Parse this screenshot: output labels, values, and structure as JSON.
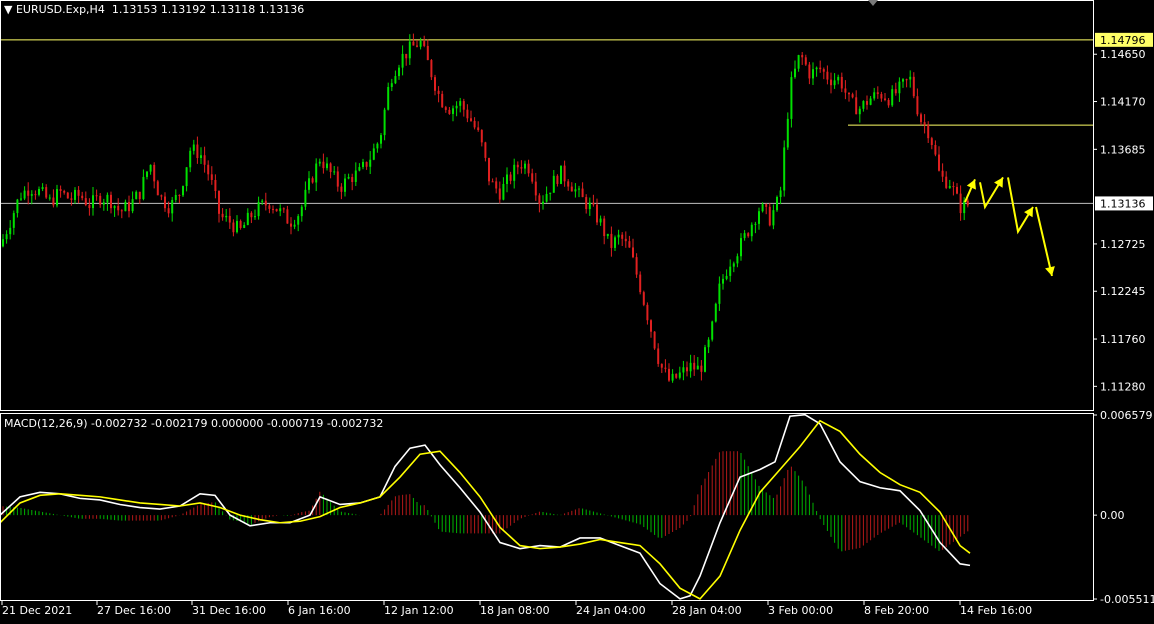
{
  "header": {
    "symbol": "EURUSD.Exp,H4",
    "ohlc": "1.13153 1.13192 1.13118 1.13136"
  },
  "macd_header": {
    "label": "MACD(12,26,9) -0.002732 -0.002179 0.000000 -0.000719 -0.002732"
  },
  "colors": {
    "background": "#000000",
    "bull_candle": "#00e000",
    "bear_candle": "#e02020",
    "frame": "#ffffff",
    "level_line": "#ffff66",
    "current_price_line": "#c0c0c0",
    "macd_main": "#ffffff",
    "macd_signal": "#ffff00",
    "arrow": "#ffff00"
  },
  "price_labels": {
    "resistance": "1.14796",
    "current": "1.13136"
  },
  "chart_data": [
    {
      "type": "candlestick",
      "title": "EURUSD.Exp,H4",
      "ylim": [
        1.1105,
        1.1518
      ],
      "y_ticks": [
        "1.14650",
        "1.14170",
        "1.13685",
        "1.12725",
        "1.12245",
        "1.11760",
        "1.11280"
      ],
      "x_ticks": [
        "21 Dec 2021",
        "27 Dec 16:00",
        "31 Dec 16:00",
        "6 Jan 16:00",
        "12 Jan 12:00",
        "18 Jan 08:00",
        "24 Jan 04:00",
        "28 Jan 04:00",
        "3 Feb 00:00",
        "8 Feb 20:00",
        "14 Feb 16:00"
      ],
      "horizontal_lines": [
        1.14796,
        1.13136,
        1.1393
      ],
      "close_path": [
        [
          0,
          1.127
        ],
        [
          10,
          1.1295
        ],
        [
          20,
          1.1322
        ],
        [
          30,
          1.133
        ],
        [
          40,
          1.1325
        ],
        [
          50,
          1.1315
        ],
        [
          60,
          1.1325
        ],
        [
          70,
          1.1318
        ],
        [
          80,
          1.1322
        ],
        [
          90,
          1.1312
        ],
        [
          100,
          1.132
        ],
        [
          110,
          1.1318
        ],
        [
          120,
          1.1305
        ],
        [
          130,
          1.1312
        ],
        [
          140,
          1.1325
        ],
        [
          150,
          1.1355
        ],
        [
          160,
          1.132
        ],
        [
          170,
          1.131
        ],
        [
          180,
          1.1325
        ],
        [
          190,
          1.1368
        ],
        [
          200,
          1.1365
        ],
        [
          210,
          1.134
        ],
        [
          220,
          1.13
        ],
        [
          230,
          1.1295
        ],
        [
          240,
          1.1285
        ],
        [
          250,
          1.13
        ],
        [
          260,
          1.131
        ],
        [
          270,
          1.1315
        ],
        [
          280,
          1.1305
        ],
        [
          290,
          1.1295
        ],
        [
          300,
          1.1305
        ],
        [
          310,
          1.1335
        ],
        [
          320,
          1.136
        ],
        [
          330,
          1.1345
        ],
        [
          340,
          1.133
        ],
        [
          350,
          1.134
        ],
        [
          360,
          1.1345
        ],
        [
          370,
          1.136
        ],
        [
          380,
          1.138
        ],
        [
          390,
          1.144
        ],
        [
          400,
          1.146
        ],
        [
          410,
          1.147
        ],
        [
          420,
          1.1478
        ],
        [
          430,
          1.145
        ],
        [
          440,
          1.142
        ],
        [
          450,
          1.141
        ],
        [
          460,
          1.1415
        ],
        [
          470,
          1.14
        ],
        [
          480,
          1.138
        ],
        [
          490,
          1.1335
        ],
        [
          500,
          1.1325
        ],
        [
          510,
          1.134
        ],
        [
          520,
          1.1355
        ],
        [
          530,
          1.135
        ],
        [
          540,
          1.1315
        ],
        [
          550,
          1.133
        ],
        [
          560,
          1.1345
        ],
        [
          570,
          1.1335
        ],
        [
          580,
          1.132
        ],
        [
          590,
          1.131
        ],
        [
          600,
          1.1295
        ],
        [
          610,
          1.127
        ],
        [
          620,
          1.128
        ],
        [
          630,
          1.1265
        ],
        [
          640,
          1.123
        ],
        [
          650,
          1.119
        ],
        [
          660,
          1.115
        ],
        [
          670,
          1.1132
        ],
        [
          680,
          1.114
        ],
        [
          690,
          1.1148
        ],
        [
          700,
          1.1145
        ],
        [
          710,
          1.1175
        ],
        [
          720,
          1.123
        ],
        [
          730,
          1.1255
        ],
        [
          740,
          1.127
        ],
        [
          750,
          1.129
        ],
        [
          760,
          1.131
        ],
        [
          770,
          1.1298
        ],
        [
          780,
          1.132
        ],
        [
          790,
          1.143
        ],
        [
          800,
          1.1465
        ],
        [
          810,
          1.1445
        ],
        [
          820,
          1.145
        ],
        [
          830,
          1.144
        ],
        [
          840,
          1.144
        ],
        [
          850,
          1.1415
        ],
        [
          860,
          1.141
        ],
        [
          870,
          1.142
        ],
        [
          880,
          1.1425
        ],
        [
          890,
          1.142
        ],
        [
          900,
          1.143
        ],
        [
          910,
          1.144
        ],
        [
          920,
          1.14
        ],
        [
          930,
          1.1385
        ],
        [
          940,
          1.134
        ],
        [
          950,
          1.1335
        ],
        [
          960,
          1.131
        ],
        [
          970,
          1.1313
        ]
      ],
      "forecast_arrows": [
        [
          [
            965,
            1.1315
          ],
          [
            975,
            1.1338
          ]
        ],
        [
          [
            980,
            1.1335
          ],
          [
            985,
            1.131
          ],
          [
            1003,
            1.134
          ]
        ],
        [
          [
            1008,
            1.134
          ],
          [
            1018,
            1.1285
          ],
          [
            1033,
            1.131
          ]
        ],
        [
          [
            1036,
            1.131
          ],
          [
            1052,
            1.124
          ]
        ]
      ]
    },
    {
      "type": "line",
      "title": "MACD(12,26,9)",
      "ylim": [
        -0.00551,
        0.006579
      ],
      "y_ticks": [
        "0.006579",
        "0.00",
        "-0.005511"
      ],
      "series": [
        {
          "values": [
            [
              0,
              0.0
            ],
            [
              20,
              0.0012
            ],
            [
              40,
              0.0015
            ],
            [
              60,
              0.0014
            ],
            [
              80,
              0.0011
            ],
            [
              100,
              0.001
            ],
            [
              120,
              0.0007
            ],
            [
              140,
              0.0005
            ],
            [
              160,
              0.0004
            ],
            [
              180,
              0.0006
            ],
            [
              200,
              0.0014
            ],
            [
              215,
              0.0013
            ],
            [
              230,
              0.0
            ],
            [
              250,
              -0.0007
            ],
            [
              270,
              -0.0005
            ],
            [
              290,
              -0.0005
            ],
            [
              310,
              0.0
            ],
            [
              320,
              0.0012
            ],
            [
              340,
              0.0007
            ],
            [
              360,
              0.0008
            ],
            [
              380,
              0.0012
            ],
            [
              395,
              0.0032
            ],
            [
              410,
              0.0044
            ],
            [
              425,
              0.0046
            ],
            [
              440,
              0.0033
            ],
            [
              460,
              0.0018
            ],
            [
              480,
              0.0002
            ],
            [
              500,
              -0.0018
            ],
            [
              520,
              -0.0022
            ],
            [
              540,
              -0.002
            ],
            [
              560,
              -0.0021
            ],
            [
              580,
              -0.0015
            ],
            [
              600,
              -0.0015
            ],
            [
              620,
              -0.002
            ],
            [
              640,
              -0.0025
            ],
            [
              660,
              -0.0045
            ],
            [
              680,
              -0.0055
            ],
            [
              690,
              -0.0053
            ],
            [
              700,
              -0.004
            ],
            [
              720,
              -0.0005
            ],
            [
              740,
              0.0025
            ],
            [
              760,
              0.003
            ],
            [
              775,
              0.0035
            ],
            [
              790,
              0.0065
            ],
            [
              805,
              0.0066
            ],
            [
              820,
              0.006
            ],
            [
              840,
              0.0035
            ],
            [
              860,
              0.0022
            ],
            [
              880,
              0.0018
            ],
            [
              900,
              0.0016
            ],
            [
              920,
              0.0003
            ],
            [
              940,
              -0.0018
            ],
            [
              960,
              -0.0032
            ],
            [
              970,
              -0.0033
            ]
          ]
        },
        {
          "values": [
            [
              0,
              -0.0005
            ],
            [
              20,
              0.0008
            ],
            [
              40,
              0.0013
            ],
            [
              60,
              0.0014
            ],
            [
              80,
              0.0013
            ],
            [
              100,
              0.0012
            ],
            [
              120,
              0.001
            ],
            [
              140,
              0.0008
            ],
            [
              160,
              0.0007
            ],
            [
              180,
              0.0006
            ],
            [
              200,
              0.0008
            ],
            [
              220,
              0.0005
            ],
            [
              240,
              0.0
            ],
            [
              260,
              -0.0003
            ],
            [
              280,
              -0.0005
            ],
            [
              300,
              -0.0004
            ],
            [
              320,
              -0.0001
            ],
            [
              340,
              0.0005
            ],
            [
              360,
              0.0008
            ],
            [
              380,
              0.0012
            ],
            [
              400,
              0.0025
            ],
            [
              420,
              0.004
            ],
            [
              440,
              0.0042
            ],
            [
              460,
              0.0028
            ],
            [
              480,
              0.0012
            ],
            [
              500,
              -0.0008
            ],
            [
              520,
              -0.002
            ],
            [
              540,
              -0.0022
            ],
            [
              560,
              -0.0021
            ],
            [
              580,
              -0.0019
            ],
            [
              600,
              -0.0016
            ],
            [
              620,
              -0.0018
            ],
            [
              640,
              -0.002
            ],
            [
              660,
              -0.0032
            ],
            [
              680,
              -0.0048
            ],
            [
              700,
              -0.0055
            ],
            [
              720,
              -0.004
            ],
            [
              740,
              -0.001
            ],
            [
              760,
              0.0015
            ],
            [
              780,
              0.003
            ],
            [
              800,
              0.0045
            ],
            [
              820,
              0.0062
            ],
            [
              840,
              0.0055
            ],
            [
              860,
              0.004
            ],
            [
              880,
              0.0028
            ],
            [
              900,
              0.002
            ],
            [
              920,
              0.0015
            ],
            [
              940,
              0.0002
            ],
            [
              960,
              -0.002
            ],
            [
              970,
              -0.0025
            ]
          ]
        }
      ]
    }
  ]
}
